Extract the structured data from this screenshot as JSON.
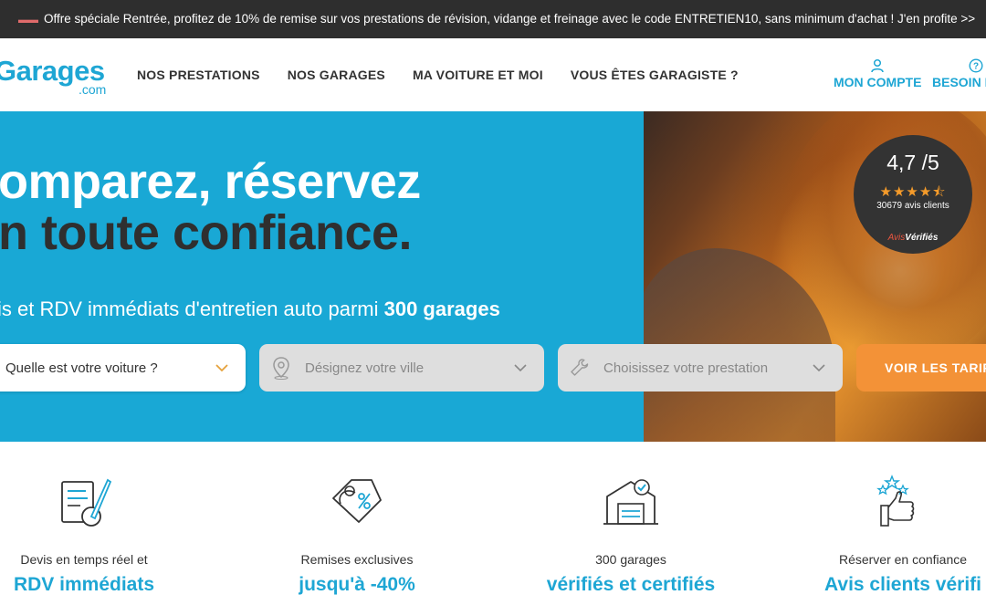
{
  "promo": {
    "text": "Offre spéciale Rentrée, profitez de 10% de remise sur vos prestations de révision, vidange et freinage avec le code ENTRETIEN10, sans minimum d'achat ! J'en profite >>"
  },
  "header": {
    "logo_main": "Garages",
    "logo_sub": ".com",
    "nav": [
      {
        "label": "NOS PRESTATIONS"
      },
      {
        "label": "NOS GARAGES"
      },
      {
        "label": "MA VOITURE ET MOI"
      },
      {
        "label": "VOUS ÊTES GARAGISTE ?"
      }
    ],
    "account_label": "MON COMPTE",
    "help_label": "BESOIN D"
  },
  "hero": {
    "title_line1": "omparez, réservez",
    "title_line2": "n toute confiance.",
    "subtitle_prefix": "is et RDV immédiats d'entretien auto parmi ",
    "subtitle_bold": "300 garages",
    "rating": {
      "score": "4,7 /5",
      "stars": 4.5,
      "count": "30679 avis clients",
      "verified_part1": "Avis",
      "verified_part2": "Vérifiés"
    },
    "search": {
      "car_label": "Quelle est votre voiture ?",
      "city_placeholder": "Désignez votre ville",
      "service_placeholder": "Choisissez votre prestation",
      "cta_label": "VOIR LES TARIF"
    }
  },
  "features": [
    {
      "icon": "document-pen-icon",
      "small": "Devis en temps réel et",
      "big": "RDV immédiats"
    },
    {
      "icon": "discount-tag-icon",
      "small": "Remises exclusives",
      "big": "jusqu'à -40%"
    },
    {
      "icon": "verified-garage-icon",
      "small": "300 garages",
      "big": "vérifiés et certifiés"
    },
    {
      "icon": "thumbs-up-stars-icon",
      "small": "Réserver en confiance",
      "big": "Avis clients vérifi"
    }
  ],
  "colors": {
    "accent_blue": "#1ea6d4",
    "hero_blue": "#19a8d5",
    "cta_orange": "#f39237",
    "promo_bg": "#2e2e2e",
    "star_orange": "#f59b2a"
  }
}
